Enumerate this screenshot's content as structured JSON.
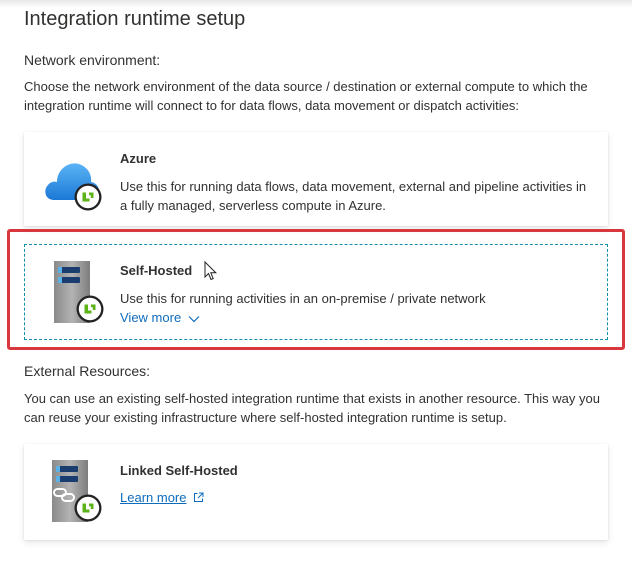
{
  "page": {
    "title": "Integration runtime setup"
  },
  "network": {
    "heading": "Network environment:",
    "description": "Choose the network environment of the data source / destination or external compute to which the integration runtime will connect to for data flows, data movement or dispatch activities:"
  },
  "options": {
    "azure": {
      "title": "Azure",
      "description": "Use this for running data flows, data movement, external and pipeline activities in a fully managed, serverless compute in Azure."
    },
    "self_hosted": {
      "title": "Self-Hosted",
      "description": "Use this for running activities in an on-premise / private network",
      "link": "View more",
      "selected": true
    }
  },
  "external": {
    "heading": "External Resources:",
    "description": "You can use an existing self-hosted integration runtime that exists in another resource. This way you can reuse your existing infrastructure where self-hosted integration runtime is setup.",
    "linked": {
      "title": "Linked Self-Hosted",
      "link": "Learn more"
    }
  },
  "icons": {
    "azure": "cloud-icon",
    "self_hosted": "server-icon",
    "linked": "linked-server-icon",
    "badge": "integration-runtime-badge-icon",
    "view_more": "chevron-down-icon",
    "learn_more": "external-link-icon"
  },
  "colors": {
    "accent": "#0f6cbd",
    "selection_border": "#0f8fa8",
    "highlight": "#d8383d",
    "badge_green": "#5bb318"
  }
}
